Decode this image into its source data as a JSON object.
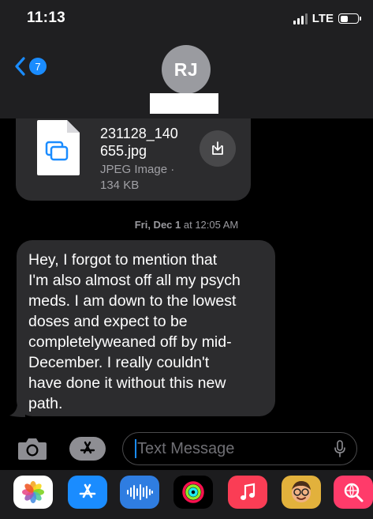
{
  "status": {
    "time": "11:13",
    "network": "LTE"
  },
  "header": {
    "back_count": "7",
    "avatar_initials": "RJ"
  },
  "attachment": {
    "name_line1": "231128_140",
    "name_line2": "655.jpg",
    "type": "JPEG Image ·",
    "size": "134 KB"
  },
  "timestamp": {
    "day": "Fri, Dec 1",
    "time": "at 12:05 AM"
  },
  "message": {
    "lines": [
      "Hey, I forgot to mention that",
      "I'm also almost off all my psych",
      "meds.  I am down to the lowest",
      "doses and expect to be",
      "completelyweaned off by mid-",
      "December.  I really couldn't",
      "have done it without this new",
      "path."
    ]
  },
  "composer": {
    "placeholder": "Text Message"
  },
  "app_drawer": {
    "apps": [
      "photos-app-icon",
      "app-store-app-icon",
      "audio-message-app-icon",
      "activity-app-icon",
      "music-app-icon",
      "memoji-app-icon",
      "search-images-app-icon"
    ]
  },
  "colors": {
    "accent": "#1a8cff",
    "bubble": "#2c2c2e",
    "header": "#1f1f21"
  }
}
